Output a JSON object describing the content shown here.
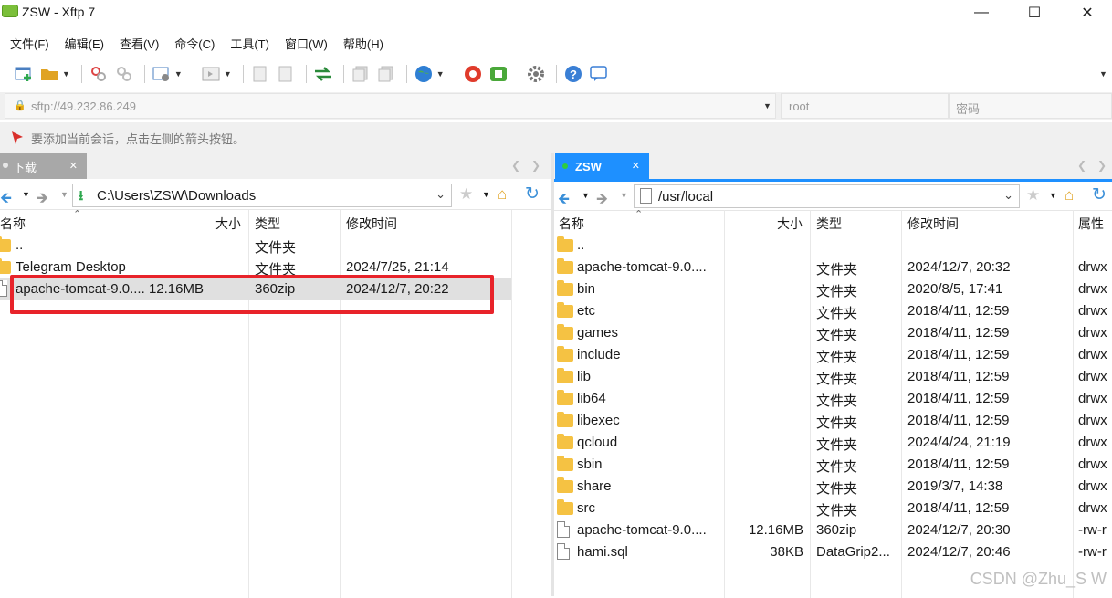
{
  "window": {
    "title": "ZSW - Xftp 7"
  },
  "menu": [
    "文件(F)",
    "编辑(E)",
    "查看(V)",
    "命令(C)",
    "工具(T)",
    "窗口(W)",
    "帮助(H)"
  ],
  "address": {
    "host_placeholder": "sftp://49.232.86.249",
    "user_placeholder": "root",
    "password_placeholder": "密码"
  },
  "hint": "要添加当前会话，点击左侧的箭头按钮。",
  "left": {
    "tab_label": "下载",
    "path": "C:\\Users\\ZSW\\Downloads",
    "headers": {
      "name": "名称",
      "size": "大小",
      "type": "类型",
      "modified": "修改时间"
    },
    "rows": [
      {
        "name": "..",
        "size": "",
        "type": "文件夹",
        "modified": "",
        "kind": "folder"
      },
      {
        "name": "Telegram Desktop",
        "size": "",
        "type": "文件夹",
        "modified": "2024/7/25, 21:14",
        "kind": "folder"
      },
      {
        "name": "apache-tomcat-9.0....",
        "size": "12.16MB",
        "type": "360zip",
        "modified": "2024/12/7, 20:22",
        "kind": "file"
      }
    ]
  },
  "right": {
    "tab_label": "ZSW",
    "path": "/usr/local",
    "headers": {
      "name": "名称",
      "size": "大小",
      "type": "类型",
      "modified": "修改时间",
      "attr": "属性"
    },
    "rows": [
      {
        "name": "..",
        "size": "",
        "type": "",
        "modified": "",
        "attr": "",
        "kind": "folder"
      },
      {
        "name": "apache-tomcat-9.0....",
        "size": "",
        "type": "文件夹",
        "modified": "2024/12/7, 20:32",
        "attr": "drwx",
        "kind": "folder"
      },
      {
        "name": "bin",
        "size": "",
        "type": "文件夹",
        "modified": "2020/8/5, 17:41",
        "attr": "drwx",
        "kind": "folder"
      },
      {
        "name": "etc",
        "size": "",
        "type": "文件夹",
        "modified": "2018/4/11, 12:59",
        "attr": "drwx",
        "kind": "folder"
      },
      {
        "name": "games",
        "size": "",
        "type": "文件夹",
        "modified": "2018/4/11, 12:59",
        "attr": "drwx",
        "kind": "folder"
      },
      {
        "name": "include",
        "size": "",
        "type": "文件夹",
        "modified": "2018/4/11, 12:59",
        "attr": "drwx",
        "kind": "folder"
      },
      {
        "name": "lib",
        "size": "",
        "type": "文件夹",
        "modified": "2018/4/11, 12:59",
        "attr": "drwx",
        "kind": "folder"
      },
      {
        "name": "lib64",
        "size": "",
        "type": "文件夹",
        "modified": "2018/4/11, 12:59",
        "attr": "drwx",
        "kind": "folder"
      },
      {
        "name": "libexec",
        "size": "",
        "type": "文件夹",
        "modified": "2018/4/11, 12:59",
        "attr": "drwx",
        "kind": "folder"
      },
      {
        "name": "qcloud",
        "size": "",
        "type": "文件夹",
        "modified": "2024/4/24, 21:19",
        "attr": "drwx",
        "kind": "folder"
      },
      {
        "name": "sbin",
        "size": "",
        "type": "文件夹",
        "modified": "2018/4/11, 12:59",
        "attr": "drwx",
        "kind": "folder"
      },
      {
        "name": "share",
        "size": "",
        "type": "文件夹",
        "modified": "2019/3/7, 14:38",
        "attr": "drwx",
        "kind": "folder"
      },
      {
        "name": "src",
        "size": "",
        "type": "文件夹",
        "modified": "2018/4/11, 12:59",
        "attr": "drwx",
        "kind": "folder"
      },
      {
        "name": "apache-tomcat-9.0....",
        "size": "12.16MB",
        "type": "360zip",
        "modified": "2024/12/7, 20:30",
        "attr": "-rw-r",
        "kind": "file"
      },
      {
        "name": "hami.sql",
        "size": "38KB",
        "type": "DataGrip2...",
        "modified": "2024/12/7, 20:46",
        "attr": "-rw-r",
        "kind": "file"
      }
    ]
  },
  "watermark": "CSDN @Zhu_S W",
  "colors": {
    "highlight_box": "#e8232a",
    "tab_active": "#1e90ff",
    "status_dot": "#2ecc40"
  }
}
